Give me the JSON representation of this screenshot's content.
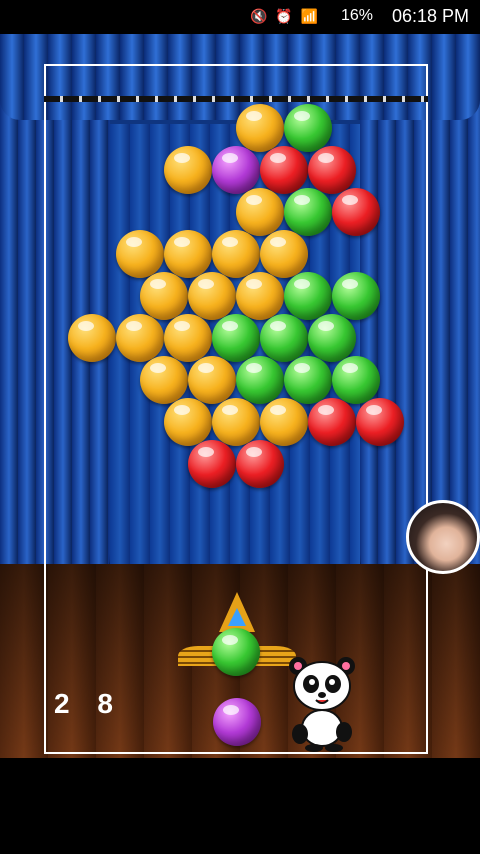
{
  "status_bar": {
    "battery_percent": "16%",
    "time": "06:18 PM",
    "icons": [
      "mute-icon",
      "alarm-icon",
      "wifi-icon",
      "signal-icon",
      "battery-icon"
    ]
  },
  "game": {
    "score": "2 8",
    "colors": {
      "orange": "#f7b21e",
      "green": "#38c832",
      "red": "#ec1f24",
      "purple": "#b23ad6",
      "frame": "#ffffff"
    },
    "bubble_grid_rows": [
      [
        "",
        "",
        "",
        "orange",
        "green",
        "",
        "",
        ""
      ],
      [
        "",
        "",
        "orange",
        "purple",
        "red",
        "red",
        "",
        ""
      ],
      [
        "",
        "",
        "",
        "orange",
        "green",
        "red",
        "",
        ""
      ],
      [
        "",
        "orange",
        "orange",
        "orange",
        "orange",
        "",
        "",
        ""
      ],
      [
        "",
        "orange",
        "orange",
        "orange",
        "green",
        "green",
        "",
        ""
      ],
      [
        "orange",
        "orange",
        "orange",
        "green",
        "green",
        "green",
        "",
        ""
      ],
      [
        "",
        "orange",
        "orange",
        "green",
        "green",
        "green",
        "",
        ""
      ],
      [
        "",
        "",
        "orange",
        "orange",
        "orange",
        "red",
        "red",
        ""
      ],
      [
        "",
        "",
        "red",
        "red",
        "",
        "",
        "",
        ""
      ]
    ],
    "loaded_bubble": "green",
    "next_bubble": "purple"
  }
}
